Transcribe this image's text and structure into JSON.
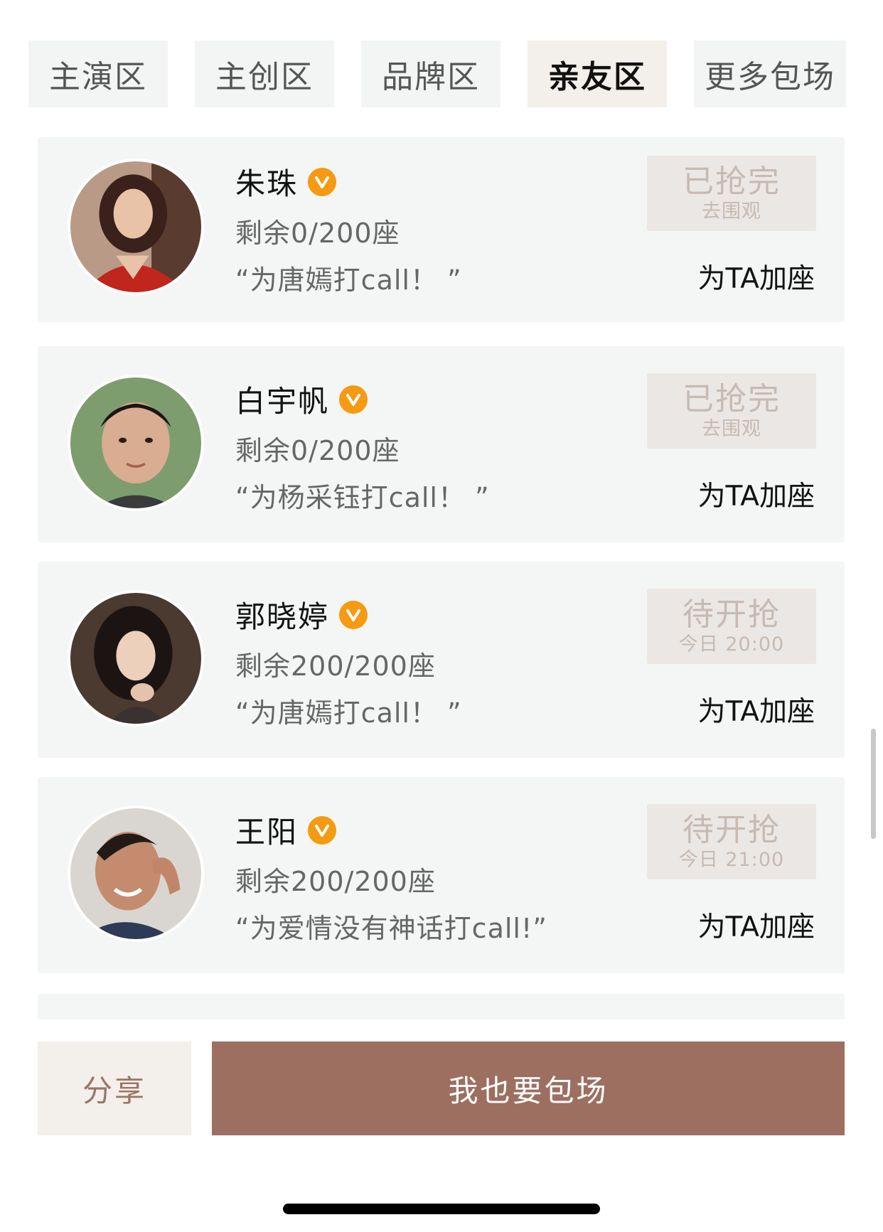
{
  "tabs": [
    {
      "label": "主演区",
      "active": false
    },
    {
      "label": "主创区",
      "active": false
    },
    {
      "label": "品牌区",
      "active": false
    },
    {
      "label": "亲友区",
      "active": true
    },
    {
      "label": "更多包场",
      "active": false
    }
  ],
  "cards": [
    {
      "name": "朱珠",
      "seats": "剩余0/200座",
      "slogan": "“为唐嫣打call！ ”",
      "status": "已抢完",
      "status_sub": "去围观",
      "action": "为TA加座"
    },
    {
      "name": "白宇帆",
      "seats": "剩余0/200座",
      "slogan": "“为杨采钰打call！ ”",
      "status": "已抢完",
      "status_sub": "去围观",
      "action": "为TA加座"
    },
    {
      "name": "郭晓婷",
      "seats": "剩余200/200座",
      "slogan": "“为唐嫣打call！ ”",
      "status": "待开抢",
      "status_sub": "今日 20:00",
      "action": "为TA加座"
    },
    {
      "name": "王阳",
      "seats": "剩余200/200座",
      "slogan": "“为爱情没有神话打call!”",
      "status": "待开抢",
      "status_sub": "今日 21:00",
      "action": "为TA加座"
    }
  ],
  "bottom": {
    "share_label": "分享",
    "main_label": "我也要包场"
  },
  "colors": {
    "accent": "#9d6f61",
    "verify_badge": "#f59a11",
    "status_text": "#c6bab2",
    "card_bg": "#f4f5f5"
  },
  "icons": {
    "verify": "verified-v-icon"
  }
}
